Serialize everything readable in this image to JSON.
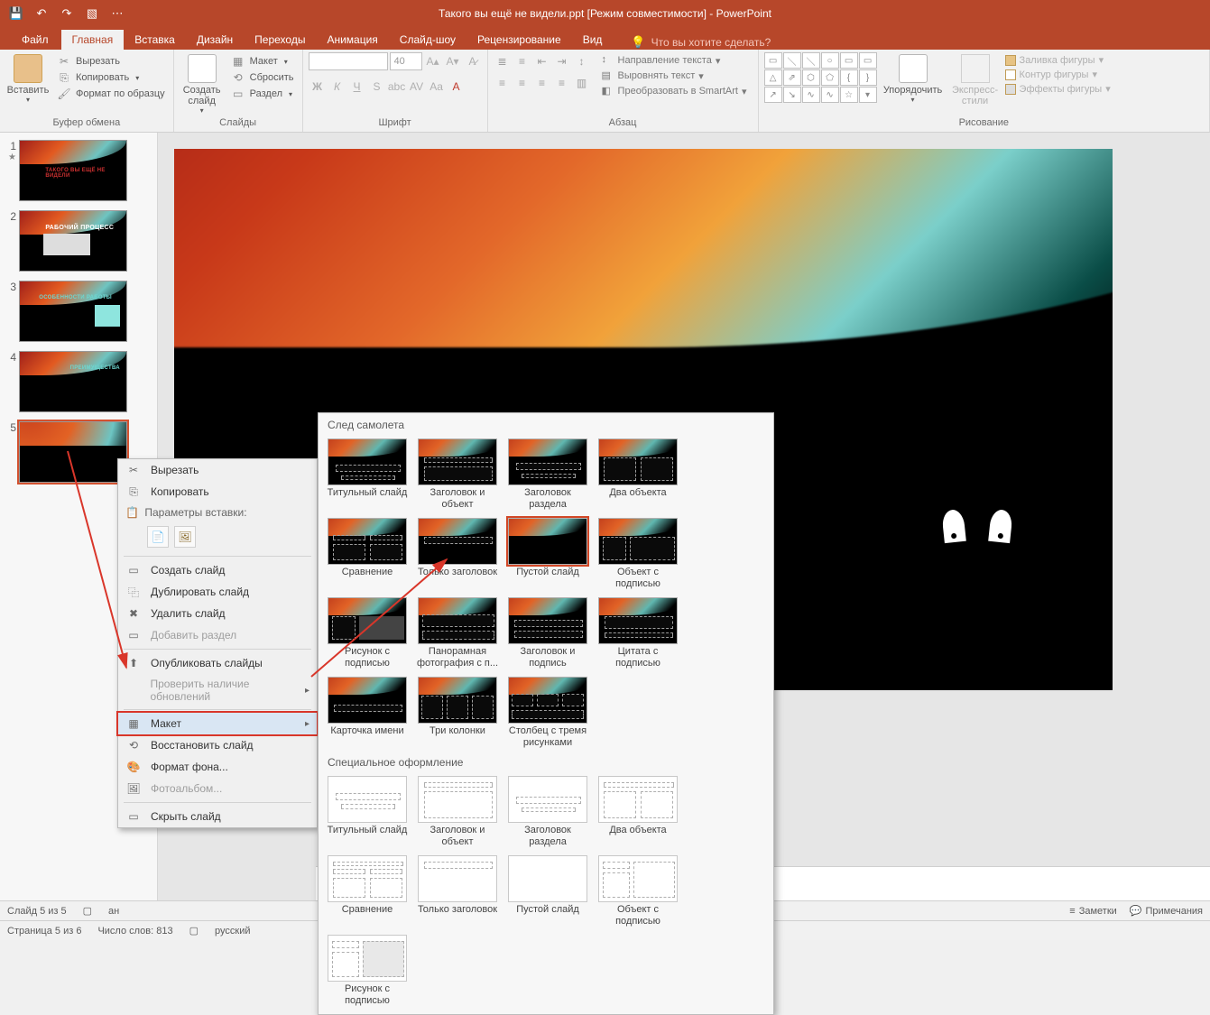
{
  "title": "Такого вы ещё не видели.ppt [Режим совместимости] - PowerPoint",
  "tabs": {
    "file": "Файл",
    "home": "Главная",
    "insert": "Вставка",
    "design": "Дизайн",
    "transitions": "Переходы",
    "animations": "Анимация",
    "slideshow": "Слайд-шоу",
    "review": "Рецензирование",
    "view": "Вид"
  },
  "tell_me": "Что вы хотите сделать?",
  "ribbon": {
    "clipboard": {
      "paste": "Вставить",
      "cut": "Вырезать",
      "copy": "Копировать",
      "format_painter": "Формат по образцу",
      "label": "Буфер обмена"
    },
    "slides": {
      "new_slide": "Создать\nслайд",
      "layout": "Макет",
      "reset": "Сбросить",
      "section": "Раздел",
      "label": "Слайды"
    },
    "font": {
      "label": "Шрифт",
      "size": "40"
    },
    "paragraph": {
      "label": "Абзац",
      "text_dir": "Направление текста",
      "align_text": "Выровнять текст",
      "smartart": "Преобразовать в SmartArt"
    },
    "drawing": {
      "arrange": "Упорядочить",
      "quick_styles": "Экспресс-\nстили",
      "fill": "Заливка фигуры",
      "outline": "Контур фигуры",
      "effects": "Эффекты фигуры",
      "label": "Рисование"
    }
  },
  "slides": [
    {
      "num": "1",
      "title": "ТАКОГО ВЫ ЕЩЁ НЕ ВИДЕЛИ"
    },
    {
      "num": "2",
      "title": "РАБОЧИЙ ПРОЦЕСС"
    },
    {
      "num": "3",
      "title": "ОСОБЕННОСТИ РАБОТЫ"
    },
    {
      "num": "4",
      "title": "ПРЕИМУЩЕСТВА"
    },
    {
      "num": "5",
      "title": ""
    }
  ],
  "context_menu": {
    "cut": "Вырезать",
    "copy": "Копировать",
    "paste_header": "Параметры вставки:",
    "new_slide": "Создать слайд",
    "duplicate": "Дублировать слайд",
    "delete": "Удалить слайд",
    "add_section": "Добавить раздел",
    "publish": "Опубликовать слайды",
    "check_updates": "Проверить наличие обновлений",
    "layout": "Макет",
    "reset": "Восстановить слайд",
    "format_bg": "Формат фона...",
    "photo_album": "Фотоальбом...",
    "hide": "Скрыть слайд"
  },
  "gallery": {
    "theme_header": "След самолета",
    "special_header": "Специальное оформление",
    "layouts_theme": [
      "Титульный слайд",
      "Заголовок и объект",
      "Заголовок раздела",
      "Два объекта",
      "Сравнение",
      "Только заголовок",
      "Пустой слайд",
      "Объект с подписью",
      "Рисунок с подписью",
      "Панорамная фотография с п...",
      "Заголовок и подпись",
      "Цитата с подписью",
      "Карточка имени",
      "Три колонки",
      "Столбец с тремя рисунками"
    ],
    "layouts_special": [
      "Титульный слайд",
      "Заголовок и объект",
      "Заголовок раздела",
      "Два объекта",
      "Сравнение",
      "Только заголовок",
      "Пустой слайд",
      "Объект с подписью",
      "Рисунок с подписью"
    ]
  },
  "status": {
    "slide_of": "Слайд 5 из 5",
    "lang": "ан",
    "page": "Страница 5 из 6",
    "words": "Число слов: 813",
    "lang2": "русский",
    "notes": "Заметки",
    "comments": "Примечания"
  }
}
